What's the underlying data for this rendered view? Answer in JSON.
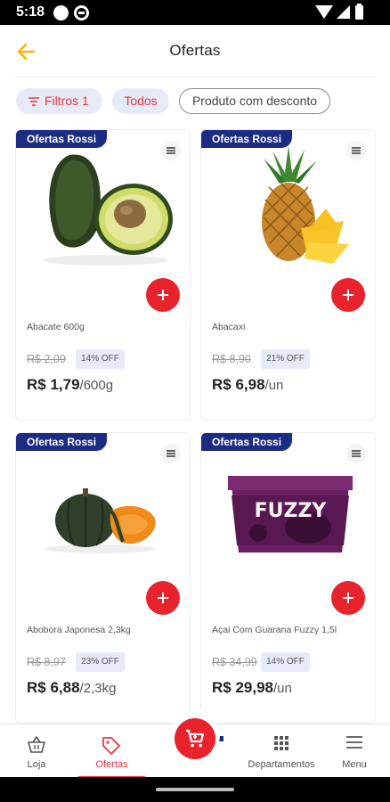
{
  "status_bar": {
    "time": "5:18"
  },
  "header": {
    "title": "Ofertas"
  },
  "chips": [
    {
      "label": "Filtros 1"
    },
    {
      "label": "Todos"
    },
    {
      "label": "Produto com desconto"
    }
  ],
  "products": [
    {
      "tag": "Ofertas Rossi",
      "name": "Abacate 600g",
      "old_price": "R$ 2,09",
      "discount": "14% OFF",
      "price": "R$ 1,79",
      "unit": "/600g",
      "image": "avocado"
    },
    {
      "tag": "Ofertas Rossi",
      "name": "Abacaxi",
      "old_price": "R$ 8,90",
      "discount": "21% OFF",
      "price": "R$ 6,98",
      "unit": "/un",
      "image": "pineapple"
    },
    {
      "tag": "Ofertas Rossi",
      "name": "Abobora Japonesa 2,3kg",
      "old_price": "R$ 8,97",
      "discount": "23% OFF",
      "price": "R$ 6,88",
      "unit": "/2,3kg",
      "image": "pumpkin"
    },
    {
      "tag": "Ofertas Rossi",
      "name": "Açai Com Guarana Fuzzy 1,5l",
      "old_price": "R$ 34,99",
      "discount": "14% OFF",
      "price": "R$ 29,98",
      "unit": "/un",
      "image": "acai-tub",
      "brand": "FUZZY"
    }
  ],
  "bottom_nav": [
    {
      "label": "Loja",
      "icon": "basket-icon"
    },
    {
      "label": "Ofertas",
      "icon": "tag-icon",
      "active": true
    },
    {
      "label": "Departamentos",
      "icon": "grid-icon"
    },
    {
      "label": "Menu",
      "icon": "hamburger-icon"
    }
  ],
  "colors": {
    "accent_red": "#e8232b",
    "brand_blue": "#1c2b83",
    "back_arrow": "#f2b705",
    "chip_bg": "#e7ebf8"
  }
}
